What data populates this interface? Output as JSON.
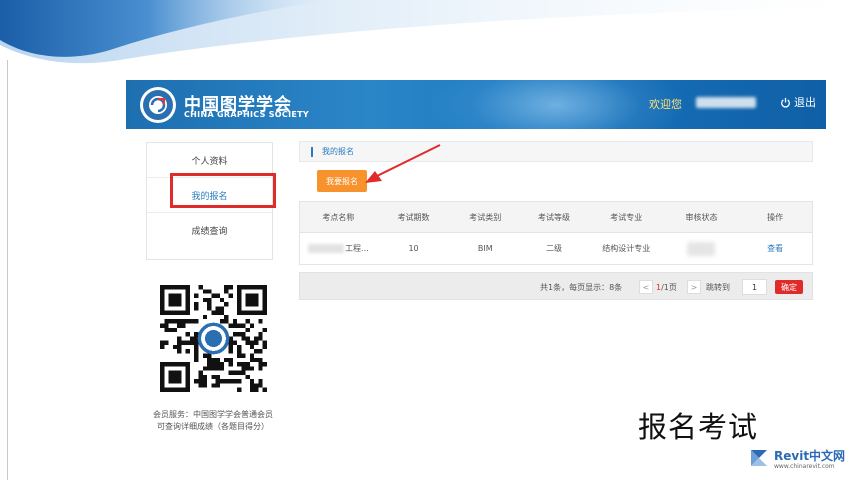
{
  "header": {
    "org_name_cn": "中国图学学会",
    "org_name_en": "CHINA GRAPHICS SOCIETY",
    "welcome_text": "欢迎您",
    "logout_label": "退出"
  },
  "sidebar": {
    "items": [
      {
        "label": "个人资料"
      },
      {
        "label": "我的报名"
      },
      {
        "label": "成绩查询"
      }
    ],
    "active_item": "我的报名",
    "member_note": "会员服务：中国图学学会普通会员可查询详细成绩（各题目得分）"
  },
  "breadcrumb": {
    "label": "我的报名"
  },
  "actions": {
    "apply_button": "我要报名"
  },
  "table": {
    "headers": [
      "考点名称",
      "考试期数",
      "考试类别",
      "考试等级",
      "考试专业",
      "审核状态",
      "操作"
    ],
    "rows": [
      {
        "site_suffix": "工程...",
        "period": "10",
        "category": "BIM",
        "level": "二级",
        "major": "结构设计专业",
        "action": "查看"
      }
    ]
  },
  "pagination": {
    "summary": "共1条，每页显示：8条",
    "prev": "<",
    "current": "1",
    "total": "/1页",
    "next": ">",
    "jump_label": "跳转到",
    "jump_value": "1",
    "confirm": "确定"
  },
  "annotation": {
    "caption": "报名考试",
    "highlight_color": "#e02b2b",
    "arrow_color": "#e02b2b"
  },
  "watermark": {
    "brand": "Revit中文网",
    "url": "www.chinarevit.com"
  },
  "colors": {
    "header_blue": "#1d6fb0",
    "link_blue": "#2a7bbf",
    "apply_orange": "#f7922d",
    "confirm_red": "#e02b2b",
    "welcome_yellow": "#ffe27a"
  }
}
